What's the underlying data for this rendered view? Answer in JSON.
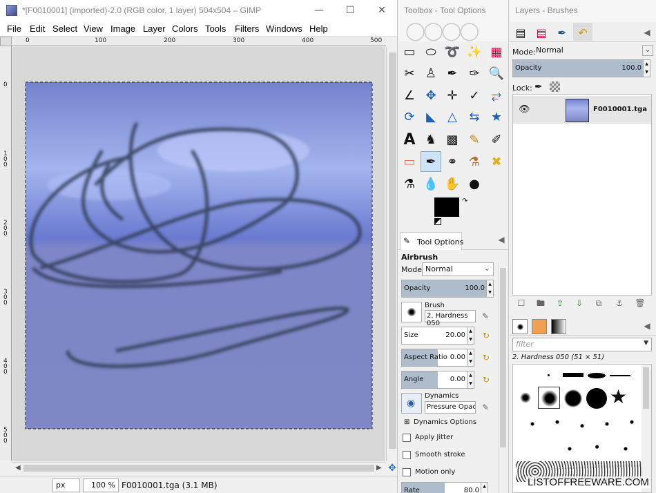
{
  "image_window": {
    "title": "*[F0010001] (imported)-2.0 (RGB color, 1 layer) 504x504 – GIMP",
    "menus": [
      "File",
      "Edit",
      "Select",
      "View",
      "Image",
      "Layer",
      "Colors",
      "Tools",
      "Filters",
      "Windows",
      "Help"
    ],
    "ruler_h": [
      "0",
      "100",
      "200",
      "300",
      "400",
      "500"
    ],
    "ruler_v": [
      "0",
      "1\n0\n0",
      "2\n0\n0",
      "3\n0\n0",
      "4\n0\n0",
      "5\n0\n0"
    ],
    "status": {
      "unit": "px",
      "zoom": "100 %",
      "file": "F0010001.tga (3.1 MB)"
    }
  },
  "toolbox": {
    "title": "Toolbox - Tool Options",
    "tool_options_tab": "Tool Options",
    "tool_name": "Airbrush",
    "mode_label": "Mode:",
    "mode_value": "Normal",
    "opacity_label": "Opacity",
    "opacity_value": "100.0",
    "brush_label": "Brush",
    "brush_value": "2. Hardness 050",
    "size_label": "Size",
    "size_value": "20.00",
    "aspect_label": "Aspect Ratio",
    "aspect_value": "0.00",
    "angle_label": "Angle",
    "angle_value": "0.00",
    "dynamics_label": "Dynamics",
    "dynamics_value": "Pressure Opacity",
    "dynamics_options": "Dynamics Options",
    "apply_jitter": "Apply Jitter",
    "smooth_stroke": "Smooth stroke",
    "motion_only": "Motion only",
    "rate_label": "Rate",
    "rate_value": "80.0",
    "fg_color": "#000000",
    "bg_color": "#ffffff"
  },
  "layers": {
    "title": "Layers - Brushes",
    "mode_label": "Mode:",
    "mode_value": "Normal",
    "opacity_label": "Opacity",
    "opacity_value": "100.0",
    "lock_label": "Lock:",
    "layer_name": "F0010001.tga",
    "filter_placeholder": "filter",
    "brush_selected": "2. Hardness 050 (51 × 51)",
    "watermark": "LISTOFFREEWARE.COM"
  }
}
